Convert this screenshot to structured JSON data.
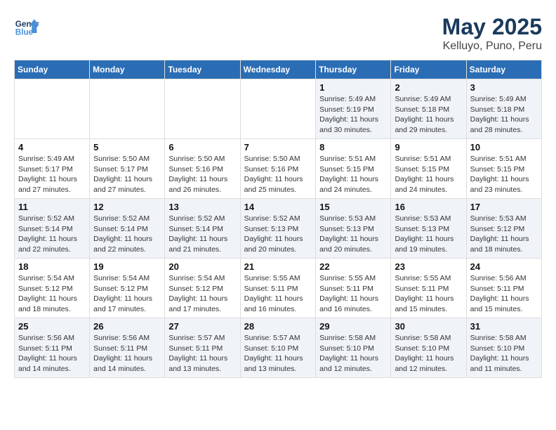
{
  "header": {
    "logo_general": "General",
    "logo_blue": "Blue",
    "month_title": "May 2025",
    "location": "Kelluyo, Puno, Peru"
  },
  "days_of_week": [
    "Sunday",
    "Monday",
    "Tuesday",
    "Wednesday",
    "Thursday",
    "Friday",
    "Saturday"
  ],
  "weeks": [
    [
      {
        "day": "",
        "info": ""
      },
      {
        "day": "",
        "info": ""
      },
      {
        "day": "",
        "info": ""
      },
      {
        "day": "",
        "info": ""
      },
      {
        "day": "1",
        "info": "Sunrise: 5:49 AM\nSunset: 5:19 PM\nDaylight: 11 hours\nand 30 minutes."
      },
      {
        "day": "2",
        "info": "Sunrise: 5:49 AM\nSunset: 5:18 PM\nDaylight: 11 hours\nand 29 minutes."
      },
      {
        "day": "3",
        "info": "Sunrise: 5:49 AM\nSunset: 5:18 PM\nDaylight: 11 hours\nand 28 minutes."
      }
    ],
    [
      {
        "day": "4",
        "info": "Sunrise: 5:49 AM\nSunset: 5:17 PM\nDaylight: 11 hours\nand 27 minutes."
      },
      {
        "day": "5",
        "info": "Sunrise: 5:50 AM\nSunset: 5:17 PM\nDaylight: 11 hours\nand 27 minutes."
      },
      {
        "day": "6",
        "info": "Sunrise: 5:50 AM\nSunset: 5:16 PM\nDaylight: 11 hours\nand 26 minutes."
      },
      {
        "day": "7",
        "info": "Sunrise: 5:50 AM\nSunset: 5:16 PM\nDaylight: 11 hours\nand 25 minutes."
      },
      {
        "day": "8",
        "info": "Sunrise: 5:51 AM\nSunset: 5:15 PM\nDaylight: 11 hours\nand 24 minutes."
      },
      {
        "day": "9",
        "info": "Sunrise: 5:51 AM\nSunset: 5:15 PM\nDaylight: 11 hours\nand 24 minutes."
      },
      {
        "day": "10",
        "info": "Sunrise: 5:51 AM\nSunset: 5:15 PM\nDaylight: 11 hours\nand 23 minutes."
      }
    ],
    [
      {
        "day": "11",
        "info": "Sunrise: 5:52 AM\nSunset: 5:14 PM\nDaylight: 11 hours\nand 22 minutes."
      },
      {
        "day": "12",
        "info": "Sunrise: 5:52 AM\nSunset: 5:14 PM\nDaylight: 11 hours\nand 22 minutes."
      },
      {
        "day": "13",
        "info": "Sunrise: 5:52 AM\nSunset: 5:14 PM\nDaylight: 11 hours\nand 21 minutes."
      },
      {
        "day": "14",
        "info": "Sunrise: 5:52 AM\nSunset: 5:13 PM\nDaylight: 11 hours\nand 20 minutes."
      },
      {
        "day": "15",
        "info": "Sunrise: 5:53 AM\nSunset: 5:13 PM\nDaylight: 11 hours\nand 20 minutes."
      },
      {
        "day": "16",
        "info": "Sunrise: 5:53 AM\nSunset: 5:13 PM\nDaylight: 11 hours\nand 19 minutes."
      },
      {
        "day": "17",
        "info": "Sunrise: 5:53 AM\nSunset: 5:12 PM\nDaylight: 11 hours\nand 18 minutes."
      }
    ],
    [
      {
        "day": "18",
        "info": "Sunrise: 5:54 AM\nSunset: 5:12 PM\nDaylight: 11 hours\nand 18 minutes."
      },
      {
        "day": "19",
        "info": "Sunrise: 5:54 AM\nSunset: 5:12 PM\nDaylight: 11 hours\nand 17 minutes."
      },
      {
        "day": "20",
        "info": "Sunrise: 5:54 AM\nSunset: 5:12 PM\nDaylight: 11 hours\nand 17 minutes."
      },
      {
        "day": "21",
        "info": "Sunrise: 5:55 AM\nSunset: 5:11 PM\nDaylight: 11 hours\nand 16 minutes."
      },
      {
        "day": "22",
        "info": "Sunrise: 5:55 AM\nSunset: 5:11 PM\nDaylight: 11 hours\nand 16 minutes."
      },
      {
        "day": "23",
        "info": "Sunrise: 5:55 AM\nSunset: 5:11 PM\nDaylight: 11 hours\nand 15 minutes."
      },
      {
        "day": "24",
        "info": "Sunrise: 5:56 AM\nSunset: 5:11 PM\nDaylight: 11 hours\nand 15 minutes."
      }
    ],
    [
      {
        "day": "25",
        "info": "Sunrise: 5:56 AM\nSunset: 5:11 PM\nDaylight: 11 hours\nand 14 minutes."
      },
      {
        "day": "26",
        "info": "Sunrise: 5:56 AM\nSunset: 5:11 PM\nDaylight: 11 hours\nand 14 minutes."
      },
      {
        "day": "27",
        "info": "Sunrise: 5:57 AM\nSunset: 5:11 PM\nDaylight: 11 hours\nand 13 minutes."
      },
      {
        "day": "28",
        "info": "Sunrise: 5:57 AM\nSunset: 5:10 PM\nDaylight: 11 hours\nand 13 minutes."
      },
      {
        "day": "29",
        "info": "Sunrise: 5:58 AM\nSunset: 5:10 PM\nDaylight: 11 hours\nand 12 minutes."
      },
      {
        "day": "30",
        "info": "Sunrise: 5:58 AM\nSunset: 5:10 PM\nDaylight: 11 hours\nand 12 minutes."
      },
      {
        "day": "31",
        "info": "Sunrise: 5:58 AM\nSunset: 5:10 PM\nDaylight: 11 hours\nand 11 minutes."
      }
    ]
  ]
}
